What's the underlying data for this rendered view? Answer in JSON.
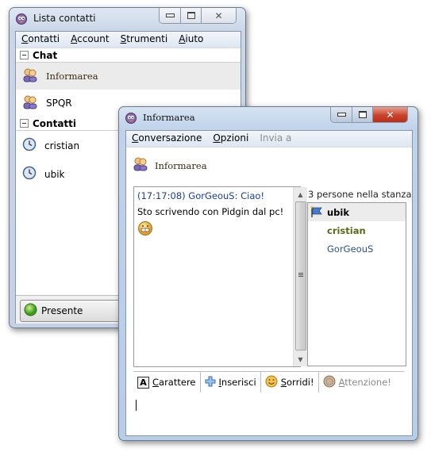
{
  "buddy_window": {
    "title": "Lista contatti",
    "menu": [
      {
        "label": "Contatti",
        "accel": "C"
      },
      {
        "label": "Account",
        "accel": "A"
      },
      {
        "label": "Strumenti",
        "accel": "S"
      },
      {
        "label": "Aiuto",
        "accel": "A"
      }
    ],
    "groups": [
      {
        "name": "Chat",
        "items": [
          {
            "label": "Informarea",
            "icon": "chat-room-icon",
            "selected": true
          },
          {
            "label": "SPQR",
            "icon": "chat-room-icon",
            "selected": false
          }
        ]
      },
      {
        "name": "Contatti",
        "items": [
          {
            "label": "cristian",
            "icon": "away-clock-icon"
          },
          {
            "label": "ubik",
            "icon": "away-clock-icon"
          }
        ]
      }
    ],
    "status": {
      "label": "Presente",
      "color": "#4caf2a"
    }
  },
  "conv_window": {
    "title": "Informarea",
    "menu": [
      {
        "label": "Conversazione",
        "accel": "C",
        "disabled": false
      },
      {
        "label": "Opzioni",
        "accel": "O",
        "disabled": false
      },
      {
        "label": "Invia a",
        "accel": "",
        "disabled": true
      }
    ],
    "header_name": "Informarea",
    "messages": [
      {
        "timestamp": "(17:17:08)",
        "sender": "GorGeouS",
        "text": "Ciao!",
        "full": "(17:17:08) GorGeouS: Ciao!"
      },
      {
        "text": "Sto scrivendo con Pidgin dal pc!"
      }
    ],
    "emoticon": "grin-icon",
    "users_count": "3 persone nella stanza",
    "users": [
      {
        "name": "ubik",
        "selected": true,
        "color": "#000000",
        "icon": "flag-icon"
      },
      {
        "name": "cristian",
        "selected": false,
        "color": "#5a6a14"
      },
      {
        "name": "GorGeouS",
        "selected": false,
        "color": "#2a4f9a"
      }
    ],
    "toolbar": [
      {
        "label": "Carattere",
        "icon": "font-icon",
        "disabled": false
      },
      {
        "label": "Inserisci",
        "icon": "insert-plus-icon",
        "disabled": false
      },
      {
        "label": "Sorridi!",
        "icon": "smiley-icon",
        "disabled": false
      },
      {
        "label": "Attenzione!",
        "icon": "attention-icon",
        "disabled": true
      }
    ],
    "entry_value": ""
  }
}
